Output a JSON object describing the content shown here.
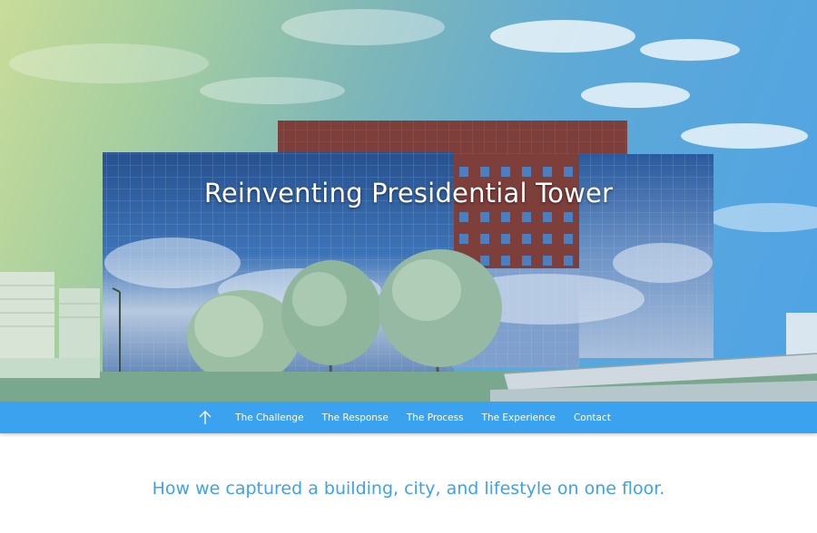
{
  "hero": {
    "title": "Reinventing Presidential Tower"
  },
  "nav": {
    "up_icon": "arrow-up-icon",
    "items": [
      {
        "label": "The Challenge"
      },
      {
        "label": "The Response"
      },
      {
        "label": "The Process"
      },
      {
        "label": "The Experience"
      },
      {
        "label": "Contact"
      }
    ]
  },
  "tagline": "How we captured a building, city, and lifestyle on one floor.",
  "colors": {
    "accent": "#3aa2ef",
    "nav_text": "#ffffff",
    "brick": "#7e3f3a",
    "glass": "#2f63a8"
  }
}
